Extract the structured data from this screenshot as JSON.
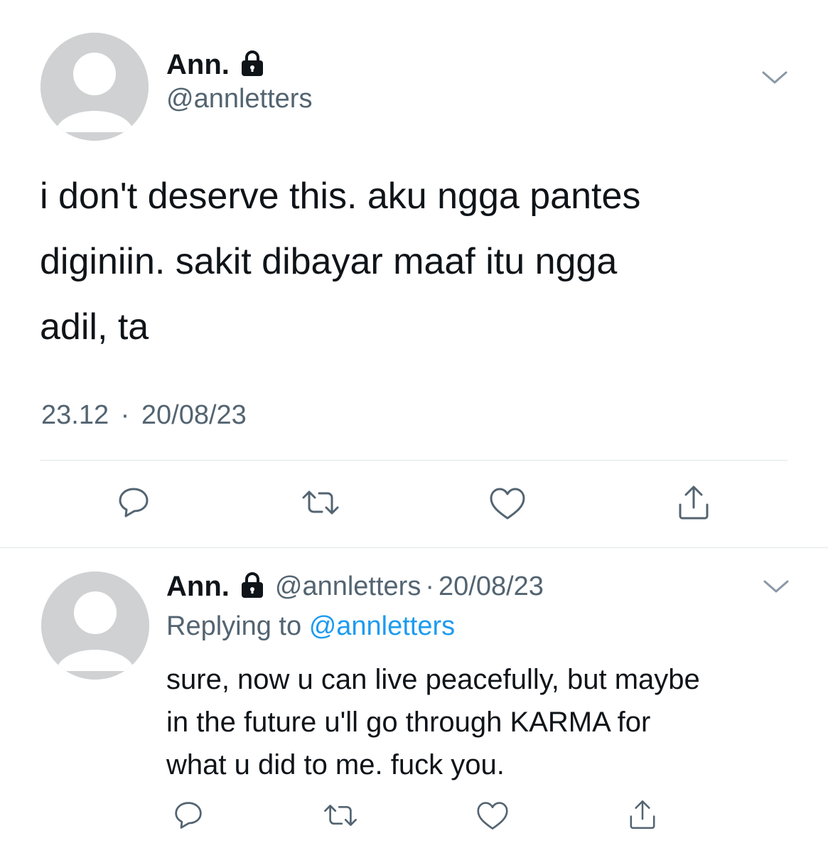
{
  "main_tweet": {
    "display_name": "Ann.",
    "handle": "@annletters",
    "text_lines": [
      "i don't deserve this. aku ngga pantes",
      "diginiin. sakit dibayar maaf itu ngga",
      "adil, ta"
    ],
    "time": "23.12",
    "separator": "·",
    "date": "20/08/23",
    "account_locked": true
  },
  "reply_tweet": {
    "display_name": "Ann.",
    "handle": "@annletters",
    "separator": "·",
    "date": "20/08/23",
    "replying_to_prefix": "Replying to",
    "replying_to_handle": "@annletters",
    "text_lines": [
      "sure, now u can live peacefully, but maybe",
      "in the future u'll go through KARMA for",
      "what u did to me. fuck you."
    ],
    "account_locked": true
  },
  "icons": {
    "avatar": "default-avatar-icon",
    "lock": "lock-icon",
    "more": "chevron-down-icon",
    "reply": "reply-icon",
    "retweet": "retweet-icon",
    "like": "heart-icon",
    "share": "share-icon"
  },
  "colors": {
    "text": "#0f1419",
    "secondary": "#536471",
    "link": "#1d9bf0",
    "avatar_bg": "#cfd1d3",
    "divider": "#e1e6ea"
  }
}
